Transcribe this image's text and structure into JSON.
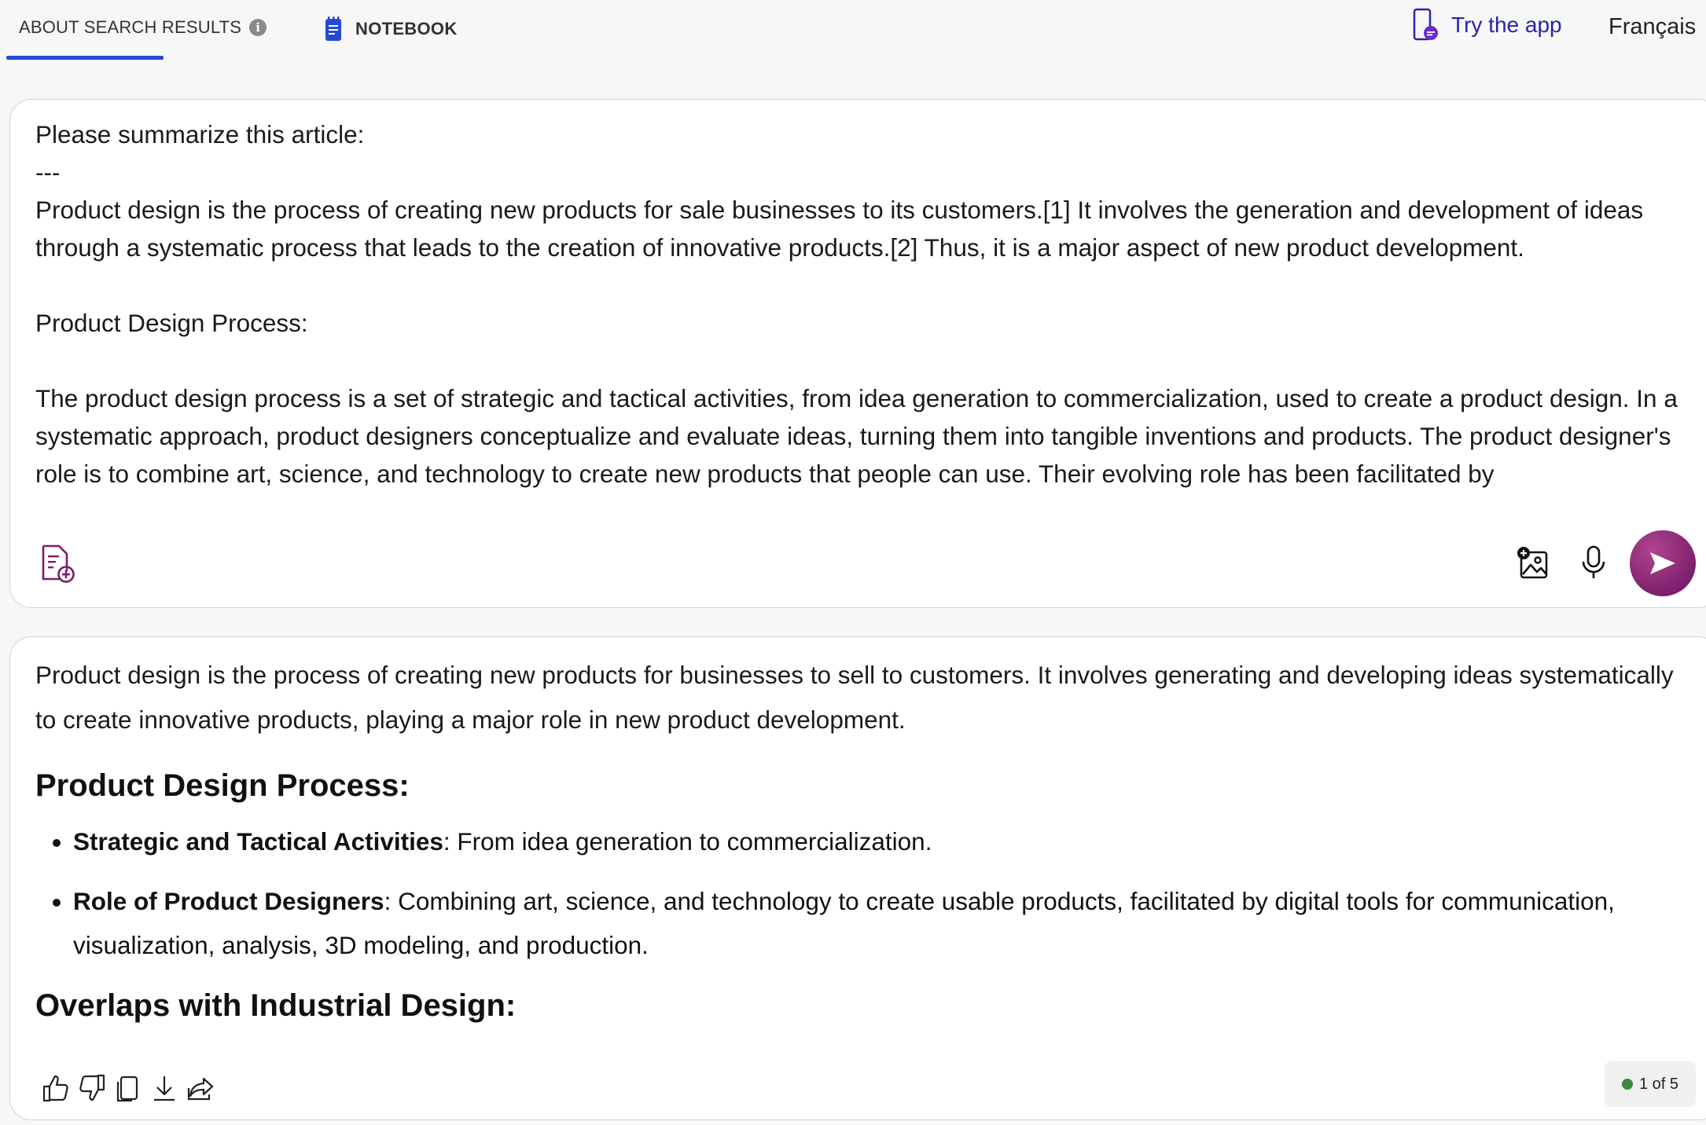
{
  "topbar": {
    "tab_about": "ABOUT SEARCH RESULTS",
    "tab_notebook": "NOTEBOOK",
    "try_app": "Try the app",
    "language": "Français",
    "accent_color": "#2848d8"
  },
  "prompt": {
    "lines": [
      "Please summarize this article:",
      "---",
      "Product design is the process of creating new products for sale businesses to its customers.[1] It involves the generation and development of ideas through a systematic process that leads to the creation of innovative products.[2] Thus, it is a major aspect of new product development.",
      "",
      "Product Design Process:",
      "",
      "The product design process is a set of strategic and tactical activities, from idea generation to commercialization, used to create a product design. In a systematic approach, product designers conceptualize and evaluate ideas, turning them into tangible inventions and products. The product designer's role is to combine art, science, and technology to create new products that people can use. Their evolving role has been facilitated by"
    ],
    "send_color": "#8b2a7a"
  },
  "response": {
    "intro": "Product design is the process of creating new products for businesses to sell to customers. It involves generating and developing ideas systematically to create innovative products, playing a major role in new product development.",
    "heading1": "Product Design Process:",
    "bullets": [
      {
        "title": "Strategic and Tactical Activities",
        "text": ": From idea generation to commercialization."
      },
      {
        "title": "Role of Product Designers",
        "text": ": Combining art, science, and technology to create usable products, facilitated by digital tools for communication, visualization, analysis, 3D modeling, and production."
      }
    ],
    "heading2": "Overlaps with Industrial Design:",
    "counter": "1 of 5",
    "counter_color": "#3c8a3c"
  }
}
